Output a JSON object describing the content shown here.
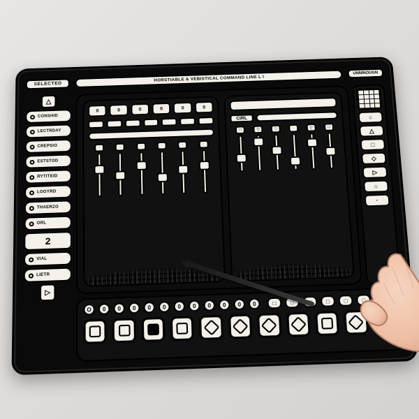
{
  "header": {
    "tab_selected": "SELECTED",
    "title": "HORSTIABLE & VEBISTICAL COMMAND LINE  L I",
    "tag_right": "UNNINOUGN"
  },
  "sidebar": {
    "top_glyph": "△",
    "items": [
      {
        "label": "CONSHID"
      },
      {
        "label": "LECTRDAY"
      },
      {
        "label": "CREPSIO"
      },
      {
        "label": "ESTSTOD"
      },
      {
        "label": "RYTITEID"
      },
      {
        "label": "LOOYRD"
      },
      {
        "label": "THAERZO"
      },
      {
        "label": "ORL"
      }
    ],
    "number": "2",
    "footer": [
      {
        "label": "VIAL"
      },
      {
        "label": "LIETR"
      }
    ],
    "play_glyph": "▷"
  },
  "panel_left": {
    "cells_top": [
      "0",
      "0",
      "0",
      "0",
      "0",
      "0"
    ],
    "cells_mid": [
      "",
      "",
      "",
      "",
      "",
      "",
      ""
    ],
    "bar_label": "",
    "slider_count": 6,
    "slider_positions": [
      42,
      30,
      48,
      24,
      38,
      44
    ]
  },
  "panel_right": {
    "readout_cells": 10,
    "label_small": "CIRL",
    "toggle_count": 6,
    "toggle_glyphs": [
      "□",
      "▽",
      "□",
      "·",
      "▽",
      "□"
    ]
  },
  "rightcol": {
    "grid_cells": 16,
    "knobs": [
      "○",
      "△",
      "□",
      "◇",
      "▷",
      "○",
      "·"
    ]
  },
  "dock": {
    "pills": [
      "O",
      "0",
      "0",
      "0",
      "0",
      "0",
      "0",
      "0",
      "0",
      "0",
      "0",
      "0"
    ],
    "squares": 9,
    "pads": [
      "square",
      "square",
      "check",
      "square",
      "diamond",
      "diamond",
      "diamond",
      "diamond",
      "square",
      "diamond",
      "play"
    ]
  },
  "colors": {
    "panel": "#0a0a0a",
    "key": "#f4f1ea",
    "ink": "#000000"
  }
}
